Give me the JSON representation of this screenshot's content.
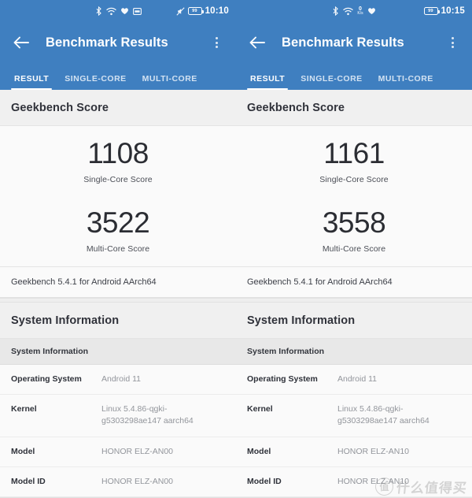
{
  "panels": [
    {
      "statusbar": {
        "icons": [
          "bluetooth-icon",
          "wifi-icon",
          "heart-icon",
          "sim-icon"
        ],
        "mute_icon": "mute-icon",
        "battery_level": "99",
        "time": "10:10"
      },
      "appbar": {
        "back_icon": "back-arrow-icon",
        "title": "Benchmark Results",
        "overflow_icon": "overflow-menu-icon"
      },
      "tabs": [
        {
          "label": "RESULT",
          "active": true
        },
        {
          "label": "SINGLE-CORE",
          "active": false
        },
        {
          "label": "MULTI-CORE",
          "active": false
        }
      ],
      "score_section": {
        "header": "Geekbench Score",
        "single_core_value": "1108",
        "single_core_label": "Single-Core Score",
        "multi_core_value": "3522",
        "multi_core_label": "Multi-Core Score",
        "version": "Geekbench 5.4.1 for Android AArch64"
      },
      "system_section": {
        "header": "System Information",
        "sub_header": "System Information",
        "rows": [
          {
            "key": "Operating System",
            "value": "Android 11"
          },
          {
            "key": "Kernel",
            "value": "Linux 5.4.86-qgki-g5303298ae147 aarch64"
          },
          {
            "key": "Model",
            "value": "HONOR ELZ-AN00"
          },
          {
            "key": "Model ID",
            "value": "HONOR ELZ-AN00"
          }
        ]
      }
    },
    {
      "statusbar": {
        "icons": [
          "bluetooth-icon",
          "wifi-icon",
          "network-speed-icon",
          "heart-icon"
        ],
        "network_speed_value": "0",
        "network_speed_unit": "K/s",
        "battery_level": "99",
        "time": "10:15"
      },
      "appbar": {
        "back_icon": "back-arrow-icon",
        "title": "Benchmark Results",
        "overflow_icon": "overflow-menu-icon"
      },
      "tabs": [
        {
          "label": "RESULT",
          "active": true
        },
        {
          "label": "SINGLE-CORE",
          "active": false
        },
        {
          "label": "MULTI-CORE",
          "active": false
        }
      ],
      "score_section": {
        "header": "Geekbench Score",
        "single_core_value": "1161",
        "single_core_label": "Single-Core Score",
        "multi_core_value": "3558",
        "multi_core_label": "Multi-Core Score",
        "version": "Geekbench 5.4.1 for Android AArch64"
      },
      "system_section": {
        "header": "System Information",
        "sub_header": "System Information",
        "rows": [
          {
            "key": "Operating System",
            "value": "Android 11"
          },
          {
            "key": "Kernel",
            "value": "Linux 5.4.86-qgki-g5303298ae147 aarch64"
          },
          {
            "key": "Model",
            "value": "HONOR ELZ-AN10"
          },
          {
            "key": "Model ID",
            "value": "HONOR ELZ-AN10"
          }
        ]
      }
    }
  ],
  "watermark": {
    "logo_char": "值",
    "text": "什么值得买"
  },
  "colors": {
    "appbar_blue": "#3f7fc0",
    "card_bg": "#fafafa",
    "header_bg": "#f0f0f0",
    "value_text": "#92959b"
  }
}
